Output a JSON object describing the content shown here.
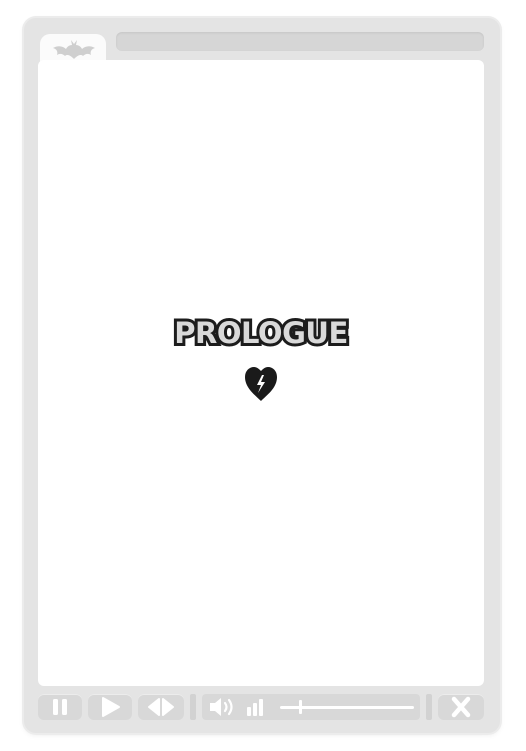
{
  "window": {
    "tab_icon": "bat-icon",
    "address_text": ""
  },
  "content": {
    "title": "PROLOGUE",
    "icon": "broken-heart-icon"
  },
  "controls": {
    "pause_icon": "pause-icon",
    "play_icon": "play-icon",
    "skip_icon": "prev-next-icon",
    "volume_icon": "speaker-icon",
    "signal_icon": "signal-bars-icon",
    "close_icon": "close-icon",
    "volume_level": 0.14
  },
  "colors": {
    "frame": "#e4e4e4",
    "content_bg": "#ffffff",
    "control_bg": "#d8d8d8",
    "title_fill": "#d9d9d9",
    "title_stroke": "#1c1c1c"
  }
}
